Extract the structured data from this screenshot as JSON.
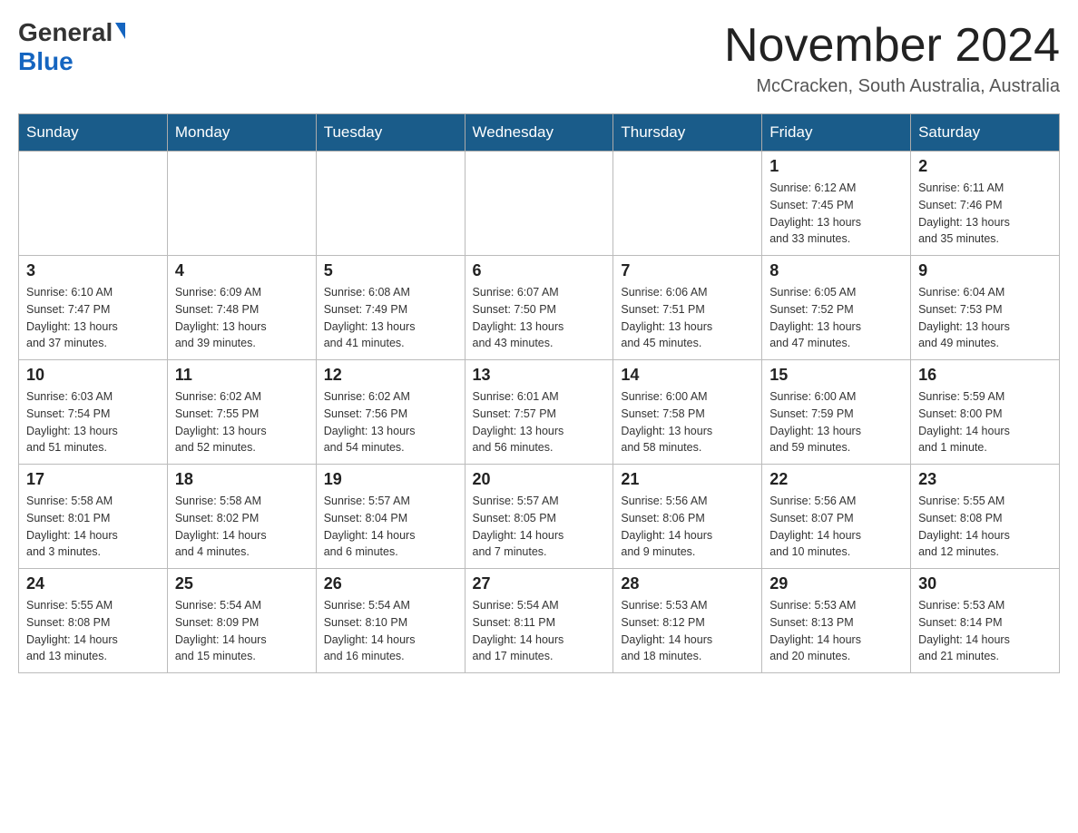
{
  "header": {
    "logo_general": "General",
    "logo_blue": "Blue",
    "main_title": "November 2024",
    "subtitle": "McCracken, South Australia, Australia"
  },
  "calendar": {
    "days_of_week": [
      "Sunday",
      "Monday",
      "Tuesday",
      "Wednesday",
      "Thursday",
      "Friday",
      "Saturday"
    ],
    "weeks": [
      {
        "days": [
          {
            "num": "",
            "info": ""
          },
          {
            "num": "",
            "info": ""
          },
          {
            "num": "",
            "info": ""
          },
          {
            "num": "",
            "info": ""
          },
          {
            "num": "",
            "info": ""
          },
          {
            "num": "1",
            "info": "Sunrise: 6:12 AM\nSunset: 7:45 PM\nDaylight: 13 hours\nand 33 minutes."
          },
          {
            "num": "2",
            "info": "Sunrise: 6:11 AM\nSunset: 7:46 PM\nDaylight: 13 hours\nand 35 minutes."
          }
        ]
      },
      {
        "days": [
          {
            "num": "3",
            "info": "Sunrise: 6:10 AM\nSunset: 7:47 PM\nDaylight: 13 hours\nand 37 minutes."
          },
          {
            "num": "4",
            "info": "Sunrise: 6:09 AM\nSunset: 7:48 PM\nDaylight: 13 hours\nand 39 minutes."
          },
          {
            "num": "5",
            "info": "Sunrise: 6:08 AM\nSunset: 7:49 PM\nDaylight: 13 hours\nand 41 minutes."
          },
          {
            "num": "6",
            "info": "Sunrise: 6:07 AM\nSunset: 7:50 PM\nDaylight: 13 hours\nand 43 minutes."
          },
          {
            "num": "7",
            "info": "Sunrise: 6:06 AM\nSunset: 7:51 PM\nDaylight: 13 hours\nand 45 minutes."
          },
          {
            "num": "8",
            "info": "Sunrise: 6:05 AM\nSunset: 7:52 PM\nDaylight: 13 hours\nand 47 minutes."
          },
          {
            "num": "9",
            "info": "Sunrise: 6:04 AM\nSunset: 7:53 PM\nDaylight: 13 hours\nand 49 minutes."
          }
        ]
      },
      {
        "days": [
          {
            "num": "10",
            "info": "Sunrise: 6:03 AM\nSunset: 7:54 PM\nDaylight: 13 hours\nand 51 minutes."
          },
          {
            "num": "11",
            "info": "Sunrise: 6:02 AM\nSunset: 7:55 PM\nDaylight: 13 hours\nand 52 minutes."
          },
          {
            "num": "12",
            "info": "Sunrise: 6:02 AM\nSunset: 7:56 PM\nDaylight: 13 hours\nand 54 minutes."
          },
          {
            "num": "13",
            "info": "Sunrise: 6:01 AM\nSunset: 7:57 PM\nDaylight: 13 hours\nand 56 minutes."
          },
          {
            "num": "14",
            "info": "Sunrise: 6:00 AM\nSunset: 7:58 PM\nDaylight: 13 hours\nand 58 minutes."
          },
          {
            "num": "15",
            "info": "Sunrise: 6:00 AM\nSunset: 7:59 PM\nDaylight: 13 hours\nand 59 minutes."
          },
          {
            "num": "16",
            "info": "Sunrise: 5:59 AM\nSunset: 8:00 PM\nDaylight: 14 hours\nand 1 minute."
          }
        ]
      },
      {
        "days": [
          {
            "num": "17",
            "info": "Sunrise: 5:58 AM\nSunset: 8:01 PM\nDaylight: 14 hours\nand 3 minutes."
          },
          {
            "num": "18",
            "info": "Sunrise: 5:58 AM\nSunset: 8:02 PM\nDaylight: 14 hours\nand 4 minutes."
          },
          {
            "num": "19",
            "info": "Sunrise: 5:57 AM\nSunset: 8:04 PM\nDaylight: 14 hours\nand 6 minutes."
          },
          {
            "num": "20",
            "info": "Sunrise: 5:57 AM\nSunset: 8:05 PM\nDaylight: 14 hours\nand 7 minutes."
          },
          {
            "num": "21",
            "info": "Sunrise: 5:56 AM\nSunset: 8:06 PM\nDaylight: 14 hours\nand 9 minutes."
          },
          {
            "num": "22",
            "info": "Sunrise: 5:56 AM\nSunset: 8:07 PM\nDaylight: 14 hours\nand 10 minutes."
          },
          {
            "num": "23",
            "info": "Sunrise: 5:55 AM\nSunset: 8:08 PM\nDaylight: 14 hours\nand 12 minutes."
          }
        ]
      },
      {
        "days": [
          {
            "num": "24",
            "info": "Sunrise: 5:55 AM\nSunset: 8:08 PM\nDaylight: 14 hours\nand 13 minutes."
          },
          {
            "num": "25",
            "info": "Sunrise: 5:54 AM\nSunset: 8:09 PM\nDaylight: 14 hours\nand 15 minutes."
          },
          {
            "num": "26",
            "info": "Sunrise: 5:54 AM\nSunset: 8:10 PM\nDaylight: 14 hours\nand 16 minutes."
          },
          {
            "num": "27",
            "info": "Sunrise: 5:54 AM\nSunset: 8:11 PM\nDaylight: 14 hours\nand 17 minutes."
          },
          {
            "num": "28",
            "info": "Sunrise: 5:53 AM\nSunset: 8:12 PM\nDaylight: 14 hours\nand 18 minutes."
          },
          {
            "num": "29",
            "info": "Sunrise: 5:53 AM\nSunset: 8:13 PM\nDaylight: 14 hours\nand 20 minutes."
          },
          {
            "num": "30",
            "info": "Sunrise: 5:53 AM\nSunset: 8:14 PM\nDaylight: 14 hours\nand 21 minutes."
          }
        ]
      }
    ]
  }
}
